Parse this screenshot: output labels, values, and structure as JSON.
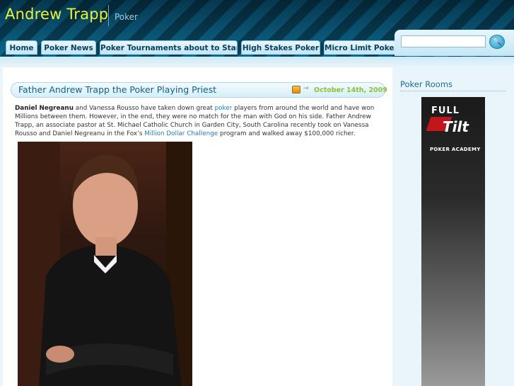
{
  "site": {
    "title": "Andrew Trapp",
    "tagline": "Poker"
  },
  "nav": {
    "items": [
      {
        "label": "Home"
      },
      {
        "label": "Poker News"
      },
      {
        "label": "Poker Tournaments about to Start"
      },
      {
        "label": "High Stakes Poker"
      },
      {
        "label": "Micro Limit Poker"
      }
    ]
  },
  "search": {
    "value": "",
    "button_icon": "search-icon"
  },
  "post": {
    "title": "Father Andrew Trapp the Poker Playing Priest",
    "date": "October 14th, 2009",
    "date_icon": "calendar-icon",
    "body": {
      "s1": "Daniel Negreanu",
      "s2": " and Vanessa Rousso have taken down great ",
      "link1": "poker",
      "s3": " players from around the world and have won Millions between them. However, in the end, they were no match for the man with God on his side. Father Andrew Trapp, an associate pastor at St. Michael Catholic Church in Garden City, South Carolina recently took on Vanessa Rousso and Daniel Negreanu in the Fox’s ",
      "link2": "Million Dollar Challenge",
      "s4": " program and walked away $100,000 richer."
    }
  },
  "sidebar": {
    "title": "Poker Rooms",
    "banner": {
      "line1": "FULL",
      "line2": "Tilt",
      "line3": "POKER ACADEMY"
    }
  },
  "colors": {
    "title": "#e9f23a",
    "link": "#1f7fb5",
    "date": "#8ac23a",
    "header": "#0a5473"
  }
}
